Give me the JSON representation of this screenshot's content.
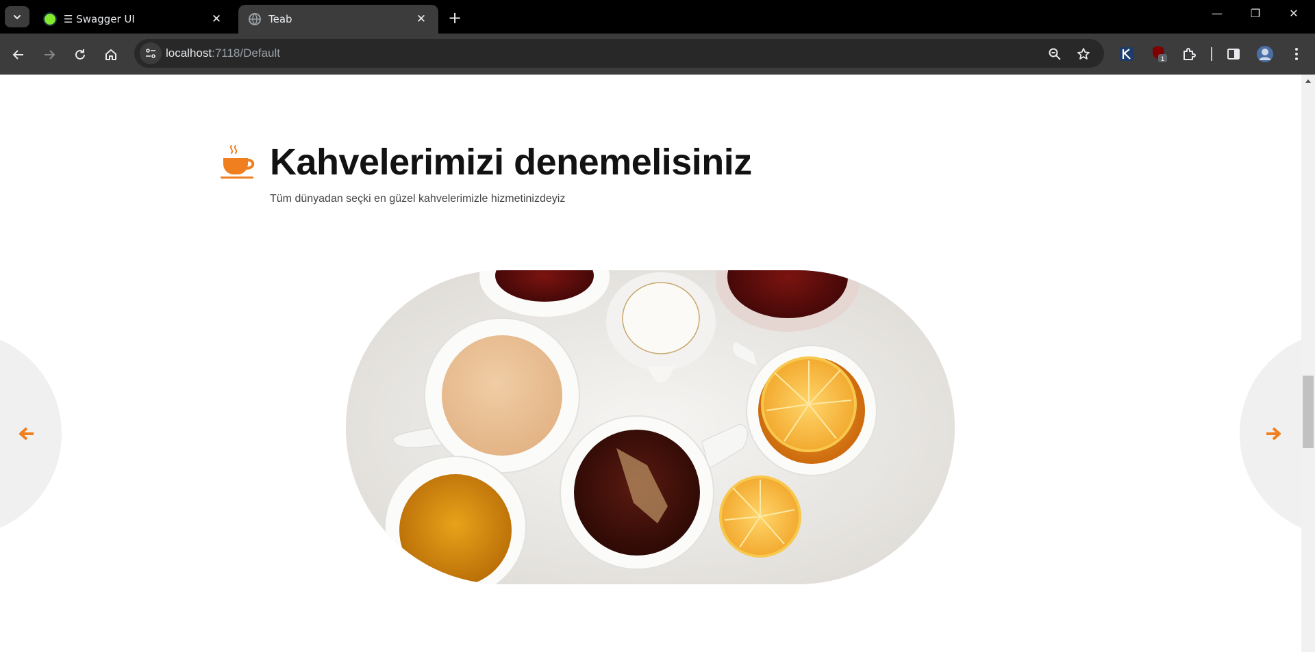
{
  "browser": {
    "tabs": [
      {
        "title": "☰ Swagger UI",
        "active": false,
        "favicon": "swagger-icon",
        "favicon_color": "#85ea2d"
      },
      {
        "title": "Teab",
        "active": true,
        "favicon": "globe-icon"
      }
    ],
    "url_host": "localhost",
    "url_rest": ":7118/Default",
    "extension_badge": "1"
  },
  "section": {
    "title": "Kahvelerimizi denemelisiniz",
    "subtitle": "Tüm dünyadan seçki en güzel kahvelerimizle hizmetinizdeyiz",
    "icon": "coffee-cup-icon"
  },
  "colors": {
    "accent": "#f07f1f",
    "chrome_dark": "#000000",
    "chrome_toolbar": "#3c3c3c",
    "text_dark": "#121212"
  },
  "carousel": {
    "image": "tea-cups-photo",
    "prev_icon": "arrow-left-icon",
    "next_icon": "arrow-right-icon"
  }
}
